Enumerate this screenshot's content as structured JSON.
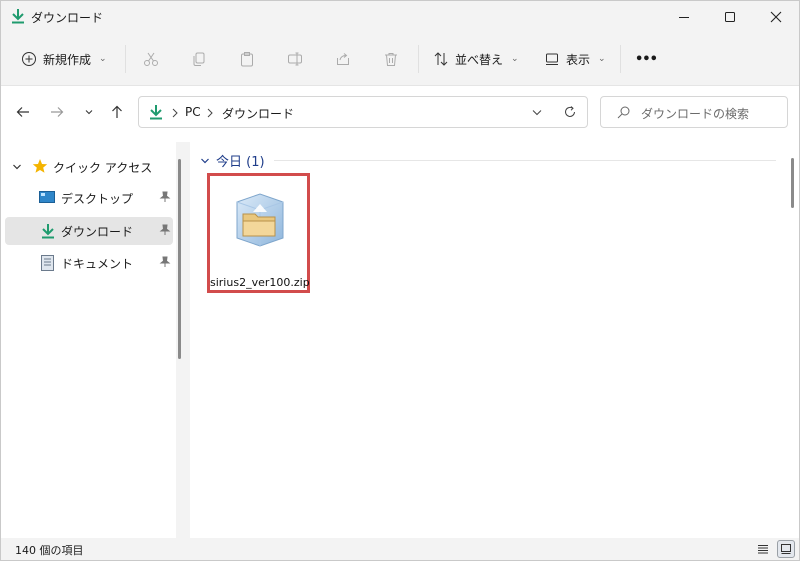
{
  "window": {
    "title": "ダウンロード",
    "minimize_icon": "minimize-icon",
    "maximize_icon": "maximize-icon",
    "close_icon": "close-icon"
  },
  "toolbar": {
    "new_label": "新規作成",
    "sort_label": "並べ替え",
    "view_label": "表示",
    "more_label": "•••"
  },
  "address": {
    "crumbs": [
      "PC",
      "ダウンロード"
    ],
    "search_placeholder": "ダウンロードの検索"
  },
  "sidebar": {
    "quick_access": "クイック アクセス",
    "items": [
      {
        "label": "デスクトップ",
        "icon": "desktop-icon"
      },
      {
        "label": "ダウンロード",
        "icon": "download-icon",
        "selected": true
      },
      {
        "label": "ドキュメント",
        "icon": "document-icon"
      }
    ]
  },
  "content": {
    "group_label": "今日 (1)",
    "files": [
      {
        "name": "sirius2_ver100.zip",
        "icon": "zip-folder-icon"
      }
    ]
  },
  "status": {
    "item_count": "140 個の項目"
  },
  "colors": {
    "accent": "#1f9b6e",
    "selection_border": "#d24c4c",
    "group_header": "#1f3d8a"
  }
}
